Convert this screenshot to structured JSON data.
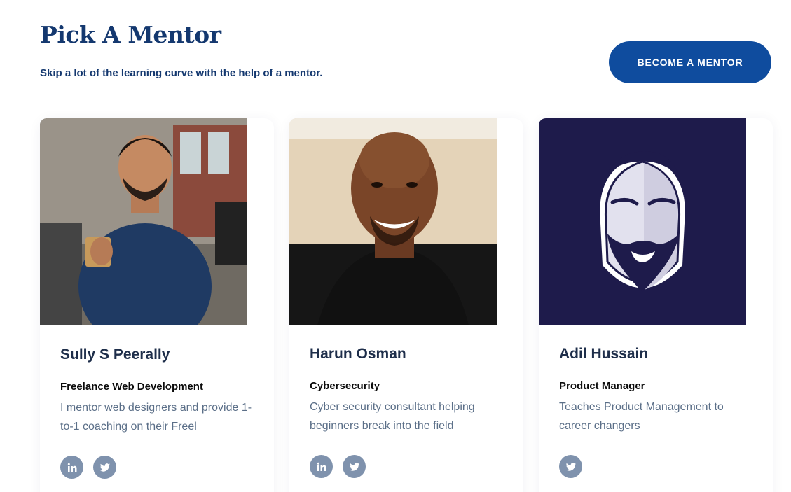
{
  "header": {
    "title": "Pick A Mentor",
    "subtitle": "Skip a lot of the learning curve with the help of a mentor.",
    "cta_label": "BECOME A MENTOR"
  },
  "mentors": [
    {
      "name": "Sully S Peerally",
      "role": "Freelance Web Development",
      "description": "I mentor web designers and provide 1-to-1 coaching on their Freel",
      "socials": [
        "linkedin-icon",
        "twitter-icon"
      ]
    },
    {
      "name": "Harun Osman",
      "role": "Cybersecurity",
      "description": "Cyber security consultant helping beginners break into the field",
      "socials": [
        "linkedin-icon",
        "twitter-icon"
      ]
    },
    {
      "name": "Adil Hussain",
      "role": "Product Manager",
      "description": "Teaches Product Management to career changers",
      "socials": [
        "twitter-icon"
      ]
    }
  ],
  "colors": {
    "brand_navy": "#14386f",
    "button_blue": "#0f4c9e",
    "social_gray": "#7f92ad",
    "avatar_bg": "#1e1b4b"
  }
}
